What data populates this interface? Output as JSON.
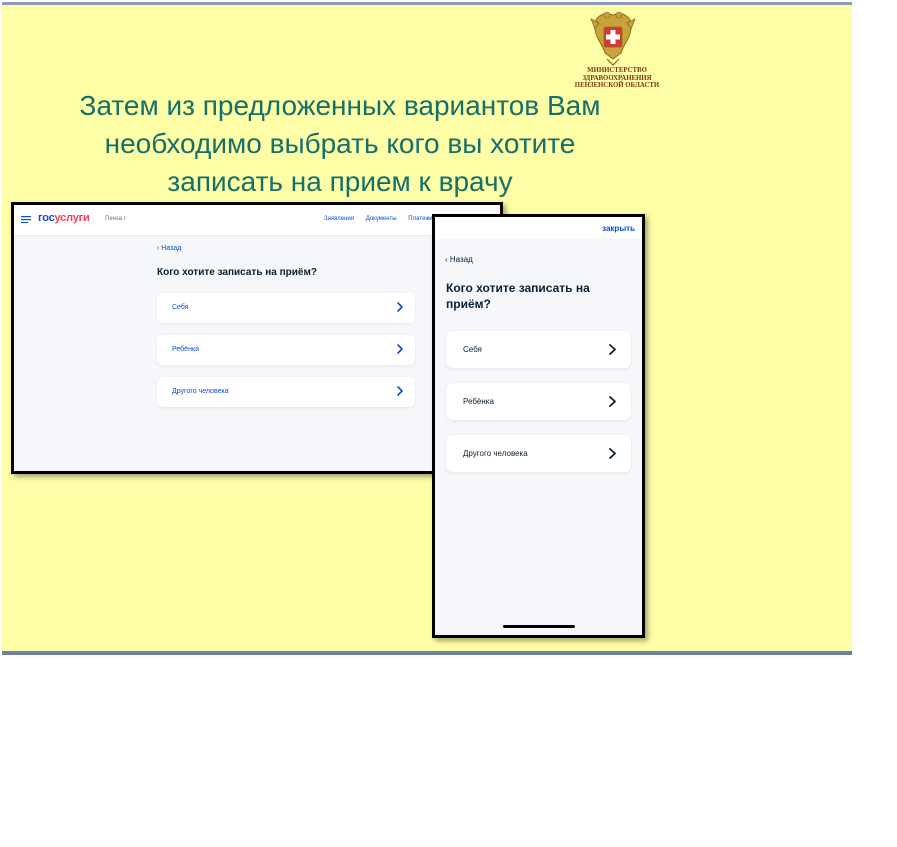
{
  "slide": {
    "title_line1": "Затем из предложенных вариантов Вам",
    "title_line2": "необходимо выбрать кого вы хотите",
    "title_line3": "записать на прием к врачу",
    "ministry_line1": "МИНИСТЕРСТВО",
    "ministry_line2": "ЗДРАВООХРАНЕНИЯ",
    "ministry_line3": "ПЕНЗЕНСКОЙ ОБЛАСТИ"
  },
  "desktop": {
    "logo_part1": "гос",
    "logo_part2": "услуги",
    "city": "Пенза г",
    "nav": [
      "Заявления",
      "Документы",
      "Платежи"
    ],
    "back": "‹ Назад",
    "question": "Кого хотите записать на приём?",
    "options": [
      "Себя",
      "Ребёнка",
      "Другого человека"
    ]
  },
  "phone": {
    "close": "закрыть",
    "back": "‹ Назад",
    "question": "Кого хотите записать на приём?",
    "options": [
      "Себя",
      "Ребёнка",
      "Другого человека"
    ]
  },
  "colors": {
    "slide_bg": "#fefea7",
    "title": "#16706a",
    "gosuslugi_blue": "#0d4cd3",
    "gosuslugi_red": "#ee3f58"
  }
}
